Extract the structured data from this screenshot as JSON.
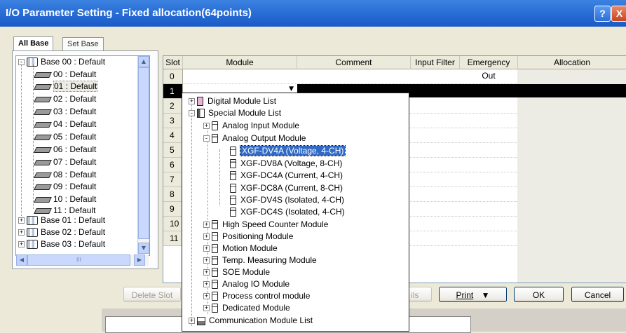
{
  "window": {
    "title": "I/O Parameter Setting - Fixed allocation(64points)",
    "help_glyph": "?",
    "close_glyph": "X"
  },
  "tabs": [
    {
      "label": "All Base",
      "active": true
    },
    {
      "label": "Set Base",
      "active": false
    }
  ],
  "tree": {
    "bases": [
      {
        "label": "Base 00 : Default",
        "expanded": true
      },
      {
        "label": "Base 01 : Default",
        "expanded": false
      },
      {
        "label": "Base 02 : Default",
        "expanded": false
      },
      {
        "label": "Base 03 : Default",
        "expanded": false
      }
    ],
    "slots": [
      "00 : Default",
      "01 : Default",
      "02 : Default",
      "03 : Default",
      "04 : Default",
      "05 : Default",
      "06 : Default",
      "07 : Default",
      "08 : Default",
      "09 : Default",
      "10 : Default",
      "11 : Default"
    ],
    "selected_slot": "01 : Default",
    "hscroll_grip": "III"
  },
  "grid": {
    "columns": [
      "Slot",
      "Module",
      "Comment",
      "Input Filter",
      "Emergency Out",
      "Allocation"
    ],
    "rows": [
      "0",
      "1",
      "2",
      "3",
      "4",
      "5",
      "6",
      "7",
      "8",
      "9",
      "10",
      "11"
    ],
    "selected_row": "1",
    "combo_value": ""
  },
  "dropdown": {
    "items": [
      {
        "label": "Digital Module List",
        "level": 0,
        "icon": "digital-module-icon",
        "toggle": "+"
      },
      {
        "label": "Special Module List",
        "level": 0,
        "icon": "folder-icon",
        "toggle": "-"
      },
      {
        "label": "Analog Input Module",
        "level": 1,
        "icon": "module-icon",
        "toggle": "+"
      },
      {
        "label": "Analog Output Module",
        "level": 1,
        "icon": "module-icon",
        "toggle": "-"
      },
      {
        "label": "XGF-DV4A (Voltage, 4-CH)",
        "level": 2,
        "icon": "module-icon",
        "toggle": "",
        "selected": true
      },
      {
        "label": "XGF-DV8A (Voltage, 8-CH)",
        "level": 2,
        "icon": "module-icon",
        "toggle": ""
      },
      {
        "label": "XGF-DC4A (Current, 4-CH)",
        "level": 2,
        "icon": "module-icon",
        "toggle": ""
      },
      {
        "label": "XGF-DC8A (Current, 8-CH)",
        "level": 2,
        "icon": "module-icon",
        "toggle": ""
      },
      {
        "label": "XGF-DV4S (Isolated, 4-CH)",
        "level": 2,
        "icon": "module-icon",
        "toggle": ""
      },
      {
        "label": "XGF-DC4S (Isolated, 4-CH)",
        "level": 2,
        "icon": "module-icon",
        "toggle": ""
      },
      {
        "label": "High Speed Counter Module",
        "level": 1,
        "icon": "module-icon",
        "toggle": "+"
      },
      {
        "label": "Positioning Module",
        "level": 1,
        "icon": "module-icon",
        "toggle": "+"
      },
      {
        "label": "Motion Module",
        "level": 1,
        "icon": "module-icon",
        "toggle": "+"
      },
      {
        "label": "Temp. Measuring Module",
        "level": 1,
        "icon": "module-icon",
        "toggle": "+"
      },
      {
        "label": "SOE Module",
        "level": 1,
        "icon": "module-icon",
        "toggle": "+"
      },
      {
        "label": "Analog IO Module",
        "level": 1,
        "icon": "module-icon",
        "toggle": "+"
      },
      {
        "label": "Process control module",
        "level": 1,
        "icon": "module-icon",
        "toggle": "+"
      },
      {
        "label": "Dedicated Module",
        "level": 1,
        "icon": "module-icon",
        "toggle": "+"
      },
      {
        "label": "Communication Module List",
        "level": 0,
        "icon": "communication-module-icon",
        "toggle": "+"
      }
    ]
  },
  "buttons": {
    "delete_slot": "Delete Slot",
    "details_partial": "ils",
    "print": "Print",
    "print_arrow": "▼",
    "ok": "OK",
    "cancel": "Cancel"
  },
  "colors": {
    "titlebar": "#2a6fd6",
    "selection": "#316ac5",
    "row_highlight": "#000000"
  }
}
